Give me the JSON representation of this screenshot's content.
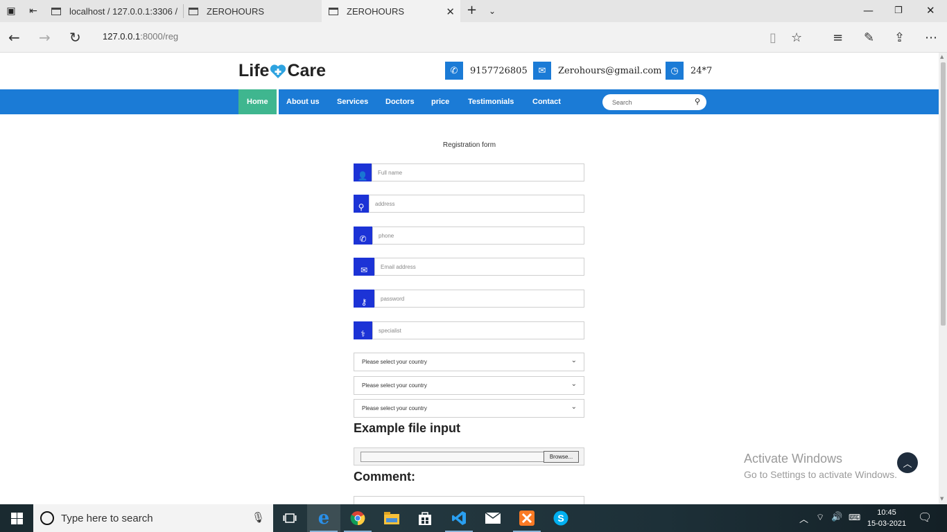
{
  "browser": {
    "tabs": [
      {
        "label": "localhost / 127.0.0.1:3306 /"
      },
      {
        "label": "ZEROHOURS"
      },
      {
        "label": "ZEROHOURS"
      }
    ],
    "url_host": "127.0.0.1",
    "url_path": ":8000/reg"
  },
  "site": {
    "logo_left": "Life",
    "logo_right": "Care",
    "phone": "9157726805",
    "email": "Zerohours@gmail.com",
    "hours": "24*7",
    "accent": "#1b7bd6",
    "nav_active_color": "#3fb68f"
  },
  "nav": {
    "items": [
      "Home",
      "About us",
      "Services",
      "Doctors",
      "price",
      "Testimonials",
      "Contact"
    ],
    "search_placeholder": "Search"
  },
  "form": {
    "title": "Registration form",
    "fields": [
      {
        "placeholder": "Full name",
        "icon": "user-icon"
      },
      {
        "placeholder": "address",
        "icon": "map-pin-icon"
      },
      {
        "placeholder": "phone",
        "icon": "phone-icon"
      },
      {
        "placeholder": "Email address",
        "icon": "envelope-icon"
      },
      {
        "placeholder": "password",
        "icon": "key-icon"
      },
      {
        "placeholder": "specialist",
        "icon": "doctor-icon"
      }
    ],
    "selects": [
      "Please select your country",
      "Please select your country",
      "Please select your country"
    ],
    "file_heading": "Example file input",
    "browse_label": "Browse...",
    "comment_heading": "Comment:"
  },
  "watermark": {
    "line1": "Activate Windows",
    "line2": "Go to Settings to activate Windows."
  },
  "taskbar": {
    "search_placeholder": "Type here to search",
    "time": "10:45",
    "date": "15-03-2021"
  }
}
